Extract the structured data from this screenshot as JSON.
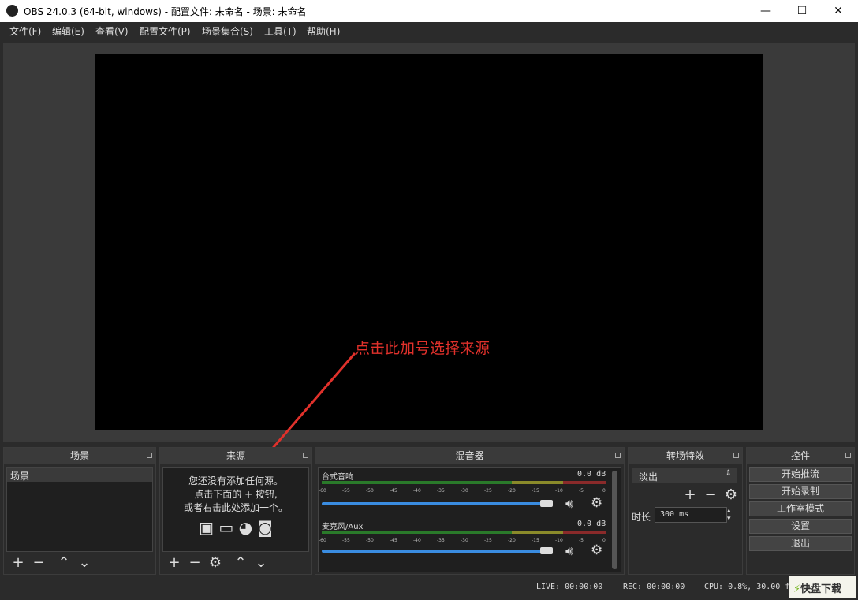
{
  "window": {
    "title": "OBS 24.0.3 (64-bit, windows) - 配置文件: 未命名 - 场景: 未命名",
    "minimize": "—",
    "maximize": "☐",
    "close": "✕"
  },
  "menu": [
    "文件(F)",
    "编辑(E)",
    "查看(V)",
    "配置文件(P)",
    "场景集合(S)",
    "工具(T)",
    "帮助(H)"
  ],
  "annotation": "点击此加号选择来源",
  "docks": {
    "scenes": {
      "title": "场景",
      "items": [
        "场景"
      ]
    },
    "sources": {
      "title": "来源",
      "empty_text": [
        "您还没有添加任何源。",
        "点击下面的 + 按钮,",
        "或者右击此处添加一个。"
      ]
    },
    "mixer": {
      "title": "混音器",
      "ticks": [
        "-60",
        "-55",
        "-50",
        "-45",
        "-40",
        "-35",
        "-30",
        "-25",
        "-20",
        "-15",
        "-10",
        "-5",
        "0"
      ],
      "channels": [
        {
          "name": "台式音响",
          "db": "0.0 dB",
          "volume": 0.95
        },
        {
          "name": "麦克风/Aux",
          "db": "0.0 dB",
          "volume": 0.95
        }
      ]
    },
    "transitions": {
      "title": "转场特效",
      "selected": "淡出",
      "duration_label": "时长",
      "duration_value": "300 ms"
    },
    "controls": {
      "title": "控件",
      "buttons": [
        "开始推流",
        "开始录制",
        "工作室模式",
        "设置",
        "退出"
      ]
    }
  },
  "status": {
    "live": "LIVE: 00:00:00",
    "rec": "REC: 00:00:00",
    "cpu": "CPU: 0.8%, 30.00 fps"
  },
  "watermark": "快盘下载",
  "colors": {
    "accent": "#3a8ce0",
    "annotation": "#e0312b"
  }
}
